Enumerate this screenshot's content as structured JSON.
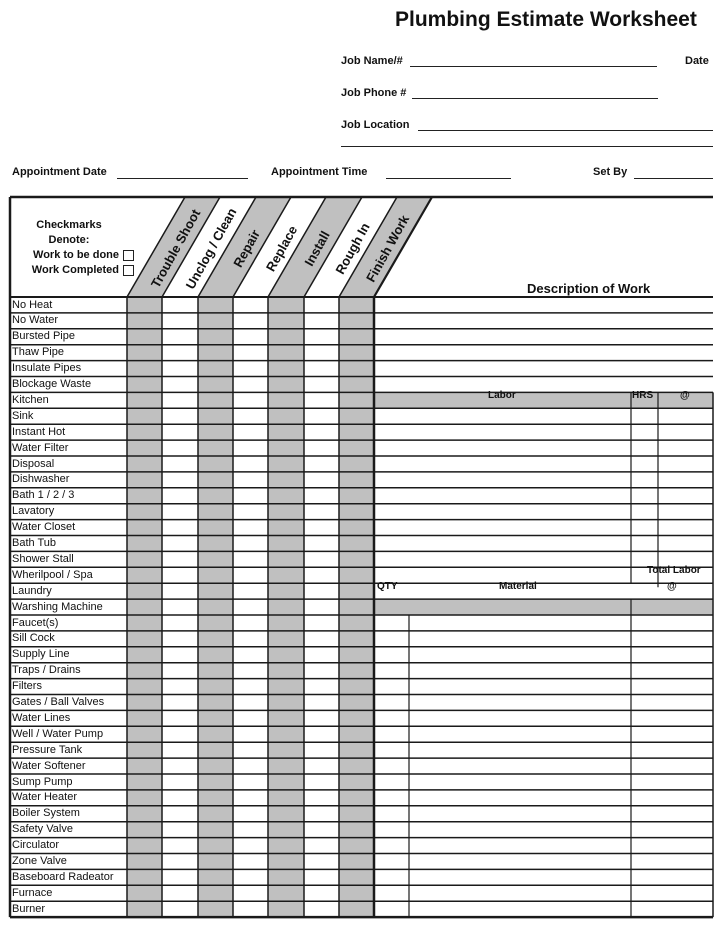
{
  "title": "Plumbing Estimate Worksheet",
  "header_fields": {
    "job_name": {
      "label": "Job Name/#",
      "value": ""
    },
    "date": {
      "label": "Date",
      "value": ""
    },
    "job_phone": {
      "label": "Job Phone #",
      "value": ""
    },
    "job_location": {
      "label": "Job Location",
      "value": ""
    },
    "appointment_date": {
      "label": "Appointment Date",
      "value": ""
    },
    "appointment_time": {
      "label": "Appointment Time",
      "value": ""
    },
    "set_by": {
      "label": "Set By",
      "value": ""
    }
  },
  "legend": {
    "heading1": "Checkmarks",
    "heading2": "Denote:",
    "work_to_be_done": "Work to be done",
    "work_completed": "Work Completed"
  },
  "columns": [
    "Trouble Shoot",
    "Unclog / Clean",
    "Repair",
    "Replace",
    "Install",
    "Rough In",
    "Finish Work"
  ],
  "shaded_columns": [
    true,
    false,
    true,
    false,
    true,
    false,
    true
  ],
  "colors": {
    "shade": "#c0c0c0",
    "line": "#1a1a1a"
  },
  "description_heading": "Description of Work",
  "labor": {
    "header": "Labor",
    "hrs": "HRS",
    "rate": "@",
    "total": "Total Labor"
  },
  "material": {
    "qty": "QTY",
    "header": "Material",
    "rate": "@"
  },
  "items": [
    "No Heat",
    "No Water",
    "Bursted Pipe",
    "Thaw Pipe",
    "Insulate Pipes",
    "Blockage Waste",
    "Kitchen",
    "Sink",
    "Instant Hot",
    "Water Filter",
    "Disposal",
    "Dishwasher",
    "Bath 1 / 2 / 3",
    "Lavatory",
    "Water Closet",
    "Bath Tub",
    "Shower Stall",
    "Wherilpool / Spa",
    "Laundry",
    "Warshing Machine",
    "Faucet(s)",
    "Sill Cock",
    "Supply Line",
    "Traps / Drains",
    "Filters",
    "Gates / Ball Valves",
    "Water Lines",
    "Well / Water Pump",
    "Pressure Tank",
    "Water Softener",
    "Sump Pump",
    "Water Heater",
    "Boiler System",
    "Safety Valve",
    "Circulator",
    "Zone Valve",
    "Baseboard Radeator",
    "Furnace",
    "Burner"
  ]
}
